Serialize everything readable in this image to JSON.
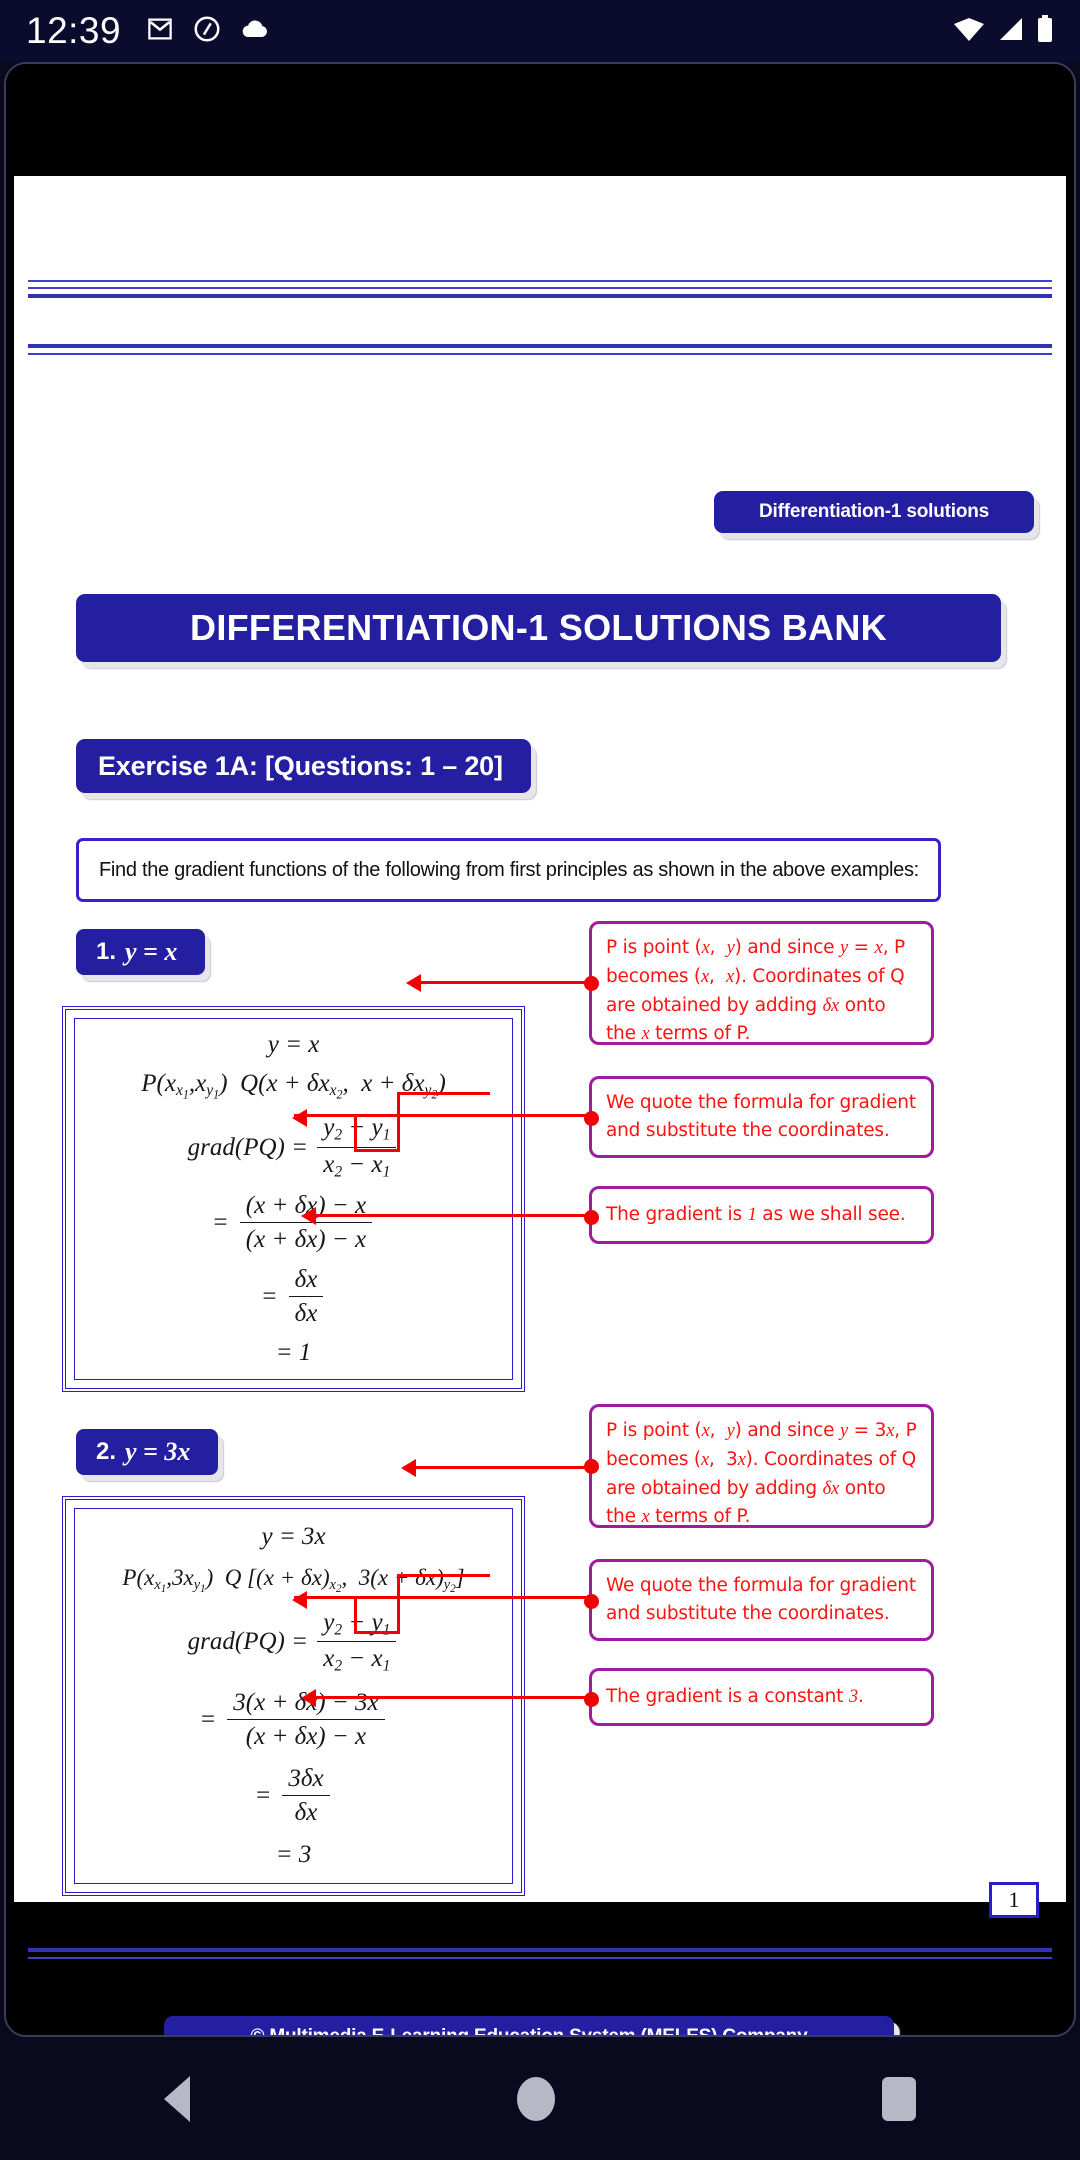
{
  "status_bar": {
    "time": "12:39",
    "icons_left": [
      "gmail-icon",
      "circle-q-icon",
      "cloud-icon"
    ],
    "icons_right": [
      "wifi-icon",
      "signal-icon",
      "battery-icon"
    ]
  },
  "document": {
    "tag_chip": "Differentiation-1 solutions",
    "main_title": "DIFFERENTIATION-1 SOLUTIONS BANK",
    "exercise_chip": "Exercise 1A:  [Questions: 1 – 20]",
    "instruction": "Find the gradient functions of the following from first principles as shown in the above examples:",
    "page_number": "1",
    "footer": "© Multimedia E-Learning Education System (MELES) Company"
  },
  "problems": [
    {
      "number": "1.",
      "equation": "y  =  x",
      "steps": {
        "line1": "y = x",
        "line2_P": "P(x",
        "line2_Q": "Q(x + δx",
        "grad_label": "grad(PQ) =",
        "grad_num": "y₂ − y₁",
        "grad_den": "x₂ − x₁",
        "sub_num": "(x + δx) − x",
        "sub_den": "(x + δx) − x",
        "delta_num": "δx",
        "delta_den": "δx",
        "result": "= 1"
      },
      "callouts": [
        "P is point (x,  y) and since y = x, P becomes (x,  x). Coordinates of Q are obtained by adding δx onto the x terms of P.",
        "We quote the formula for gradient and substitute the coordinates.",
        "The gradient is 1 as we shall see."
      ]
    },
    {
      "number": "2.",
      "equation": "y = 3x",
      "steps": {
        "line1": "y = 3x",
        "grad_label": "grad(PQ) =",
        "grad_num": "y₂ − y₁",
        "grad_den": "x₂ − x₁",
        "sub_num": "3(x + δx) − 3x",
        "sub_den": "(x + δx) − x",
        "delta_num": "3δx",
        "delta_den": "δx",
        "result": "= 3"
      },
      "callouts": [
        "P is point (x,  y) and since y = 3x, P becomes (x,  3x). Coordinates of Q are obtained by adding δx onto the x terms of P.",
        "We quote the formula for gradient and substitute the coordinates.",
        "The gradient is a constant 3."
      ]
    }
  ],
  "nav_bar": {
    "back": "back-button",
    "home": "home-button",
    "recent": "recent-apps-button"
  },
  "colors": {
    "plaque_blue": "#241ea0",
    "border_blue": "#2a1ec8",
    "callout_border": "#a01ba0",
    "callout_text": "#ff1212",
    "arrow_red": "#f20000"
  }
}
